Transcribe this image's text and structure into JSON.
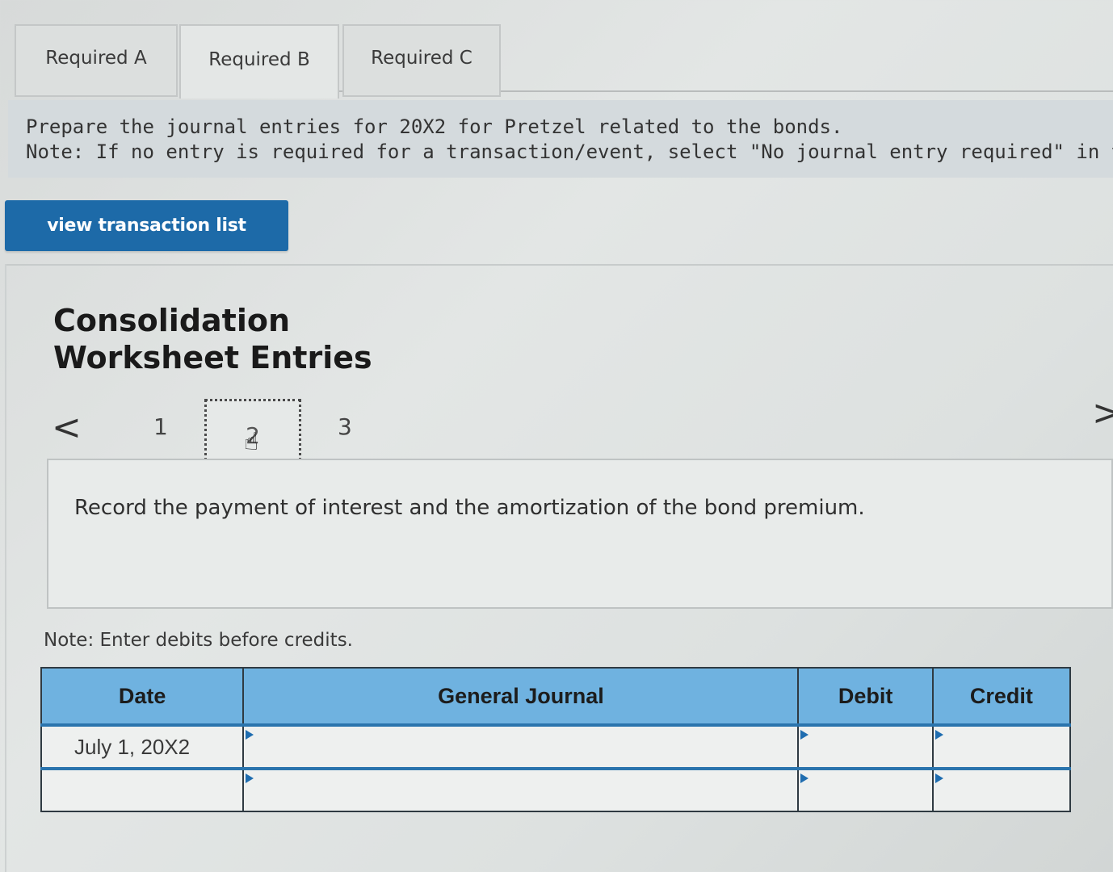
{
  "tabs": [
    {
      "label": "Required A",
      "active": false
    },
    {
      "label": "Required B",
      "active": true
    },
    {
      "label": "Required C",
      "active": false
    }
  ],
  "instructions": {
    "line1": "Prepare the journal entries for 20X2 for Pretzel related to the bonds.",
    "line2": "Note: If no entry is required for a transaction/event, select \"No journal entry required\" in the firs"
  },
  "view_button": {
    "label": "view transaction list"
  },
  "section": {
    "title_line1": "Consolidation",
    "title_line2": "Worksheet Entries"
  },
  "pagination": {
    "prev": "<",
    "next": ">",
    "pages": [
      "1",
      "2",
      "3"
    ],
    "current": "2"
  },
  "card": {
    "text": "Record the payment of interest and the amortization of the bond premium."
  },
  "debit_note": "Note: Enter debits before credits.",
  "table": {
    "headers": {
      "date": "Date",
      "general_journal": "General Journal",
      "debit": "Debit",
      "credit": "Credit"
    },
    "rows": [
      {
        "date": "July 1, 20X2",
        "general_journal": "",
        "debit": "",
        "credit": ""
      },
      {
        "date": "",
        "general_journal": "",
        "debit": "",
        "credit": ""
      }
    ]
  },
  "colors": {
    "button_blue": "#1d6aa8",
    "header_blue": "#6fb2e0",
    "row_line_blue": "#2a74ad"
  }
}
